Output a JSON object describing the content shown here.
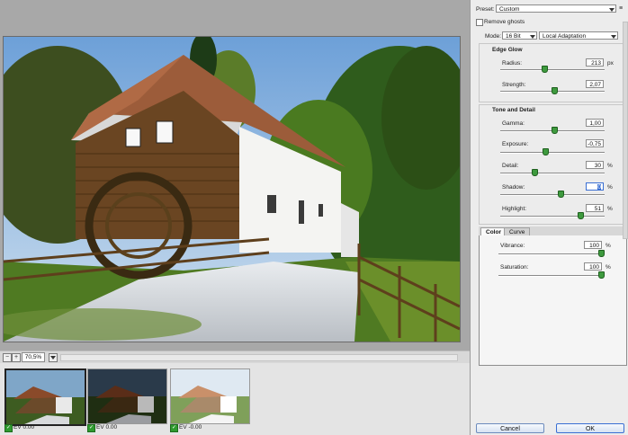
{
  "preview": {
    "zoom_value": "70,5%",
    "zoom_minus": "−",
    "zoom_plus": "+"
  },
  "filmstrip": [
    {
      "ev": "EV 0.00",
      "checked": true
    },
    {
      "ev": "EV 0.00",
      "checked": true
    },
    {
      "ev": "EV -0.00",
      "checked": true
    }
  ],
  "panel": {
    "preset_label": "Preset:",
    "preset_value": "Custom",
    "remove_ghosts_label": "Remove ghosts",
    "mode_label": "Mode:",
    "mode_bit": "16 Bit",
    "mode_method": "Local Adaptation",
    "edge_glow_title": "Edge Glow",
    "radius_label": "Radius:",
    "radius_value": "213",
    "radius_unit": "px",
    "strength_label": "Strength:",
    "strength_value": "2,07",
    "tone_title": "Tone and Detail",
    "gamma_label": "Gamma:",
    "gamma_value": "1,00",
    "exposure_label": "Exposure:",
    "exposure_value": "-0,75",
    "detail_label": "Detail:",
    "detail_value": "30",
    "detail_unit": "%",
    "shadow_label": "Shadow:",
    "shadow_value": "0",
    "shadow_unit": "%",
    "highlight_label": "Highlight:",
    "highlight_value": "51",
    "highlight_unit": "%",
    "tab_color": "Color",
    "tab_curve": "Curve",
    "vibrance_label": "Vibrance:",
    "vibrance_value": "100",
    "vibrance_unit": "%",
    "saturation_label": "Saturation:",
    "saturation_value": "100",
    "saturation_unit": "%",
    "cancel_label": "Cancel",
    "ok_label": "OK",
    "slider_levels": {
      "radius": 0.42,
      "strength": 0.52,
      "gamma": 0.52,
      "exposure": 0.43,
      "detail": 0.33,
      "shadow": 0.58,
      "highlight": 0.77,
      "vibrance": 0.98,
      "saturation": 0.98
    }
  }
}
